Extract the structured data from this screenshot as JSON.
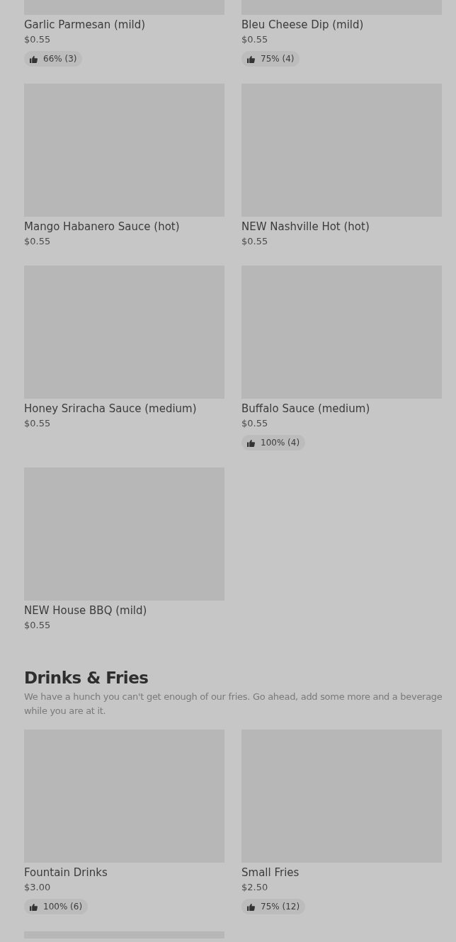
{
  "sections": [
    {
      "items": [
        {
          "title": "Garlic Parmesan (mild)",
          "price": "$0.55",
          "rating": "66% (3)"
        },
        {
          "title": "Bleu Cheese Dip (mild)",
          "price": "$0.55",
          "rating": "75% (4)"
        },
        {
          "title": "Mango Habanero Sauce (hot)",
          "price": "$0.55"
        },
        {
          "title": "NEW Nashville Hot (hot)",
          "price": "$0.55"
        },
        {
          "title": "Honey Sriracha Sauce (medium)",
          "price": "$0.55"
        },
        {
          "title": "Buffalo Sauce (medium)",
          "price": "$0.55",
          "rating": "100% (4)"
        },
        {
          "title": "NEW House BBQ (mild)",
          "price": "$0.55"
        }
      ]
    },
    {
      "heading": "Drinks & Fries",
      "description": "We have a hunch you can't get enough of our fries. Go ahead, add some more and a beverage while you are at it.",
      "items": [
        {
          "title": "Fountain Drinks",
          "price": "$3.00",
          "rating": "100% (6)"
        },
        {
          "title": "Small Fries",
          "price": "$2.50",
          "rating": "75% (12)"
        },
        {
          "kind": "picture"
        }
      ]
    }
  ]
}
